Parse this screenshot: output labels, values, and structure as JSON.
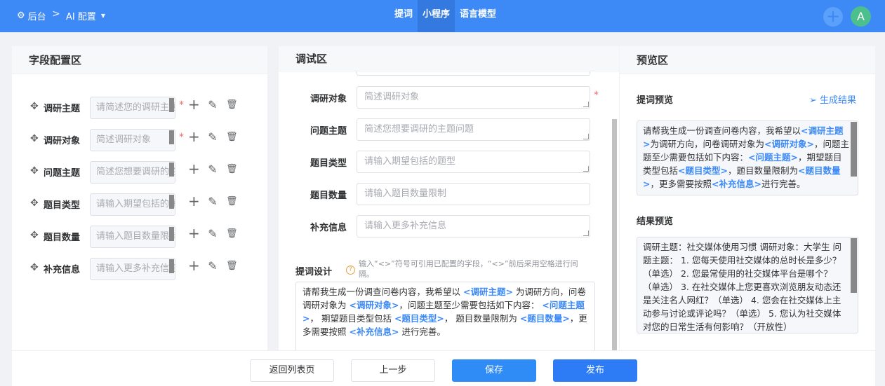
{
  "header": {
    "home_label": "后台",
    "separator": ">",
    "ai_config_label": "AI 配置",
    "tabs": [
      {
        "label": "提词",
        "active": false
      },
      {
        "label": "小程序",
        "active": true
      },
      {
        "label": "语言模型",
        "active": false
      }
    ],
    "avatar_letter": "A",
    "add_symbol": "+"
  },
  "field_panel": {
    "title": "字段配置区",
    "rows": [
      {
        "label": "调研主题",
        "placeholder": "请简述您的调研主题",
        "required": true
      },
      {
        "label": "调研对象",
        "placeholder": "简述调研对象",
        "required": true
      },
      {
        "label": "问题主题",
        "placeholder": "简述您想要调研的主题问题",
        "required": false
      },
      {
        "label": "题目类型",
        "placeholder": "请输入期望包括的题型",
        "required": false
      },
      {
        "label": "题目数量",
        "placeholder": "请输入题目数量限制",
        "required": false
      },
      {
        "label": "补充信息",
        "placeholder": "请输入更多补充信息",
        "required": false
      }
    ],
    "required_mark": "*",
    "icons": {
      "drag": "drag-move-icon",
      "add": "plus-icon",
      "edit": "edit-icon",
      "delete": "trash-icon"
    }
  },
  "debug_panel": {
    "title": "调试区",
    "fields": [
      {
        "label": "调研对象",
        "placeholder": "简述调研对象",
        "required": true
      },
      {
        "label": "问题主题",
        "placeholder": "简述您想要调研的主题问题",
        "required": false
      },
      {
        "label": "题目类型",
        "placeholder": "请输入期望包括的题型",
        "required": false
      },
      {
        "label": "题目数量",
        "placeholder": "请输入题目数量限制",
        "required": false
      },
      {
        "label": "补充信息",
        "placeholder": "请输入更多补充信息",
        "required": false
      }
    ],
    "prompt_label": "提词设计",
    "prompt_hint": "输入“<>”符号可引用已配置的字段，“<>”前后采用空格进行间隔。",
    "prompt_parts": [
      {
        "t": "请帮我生成一份调查问卷内容，我希望以 ",
        "tag": false
      },
      {
        "t": "<调研主题>",
        "tag": true
      },
      {
        "t": " 为调研方向，问卷调研对象为 ",
        "tag": false
      },
      {
        "t": "<调研对象>",
        "tag": true
      },
      {
        "t": "，问题主题至少需要包括如下内容：  ",
        "tag": false
      },
      {
        "t": "<问题主题>",
        "tag": true
      },
      {
        "t": "，  期望题目类型包括 ",
        "tag": false
      },
      {
        "t": "<题目类型>",
        "tag": true
      },
      {
        "t": "，  题目数量限制为 ",
        "tag": false
      },
      {
        "t": "<题目数量>",
        "tag": true
      },
      {
        "t": "，更多需要按照 ",
        "tag": false
      },
      {
        "t": "<补充信息>",
        "tag": true
      },
      {
        "t": " 进行完善。",
        "tag": false
      }
    ]
  },
  "preview_panel": {
    "title": "预览区",
    "prompt_preview_label": "提词预览",
    "generate_label": "生成结果",
    "prompt_preview_parts": [
      {
        "t": "请帮我生成一份调查问卷内容，我希望以",
        "tag": false
      },
      {
        "t": "<调研主题>",
        "tag": true
      },
      {
        "t": "为调研方向，问卷调研对象为",
        "tag": false
      },
      {
        "t": "<调研对象>",
        "tag": true
      },
      {
        "t": "，问题主题至少需要包括如下内容：",
        "tag": false
      },
      {
        "t": "<问题主题>",
        "tag": true
      },
      {
        "t": "，期望题目类型包括",
        "tag": false
      },
      {
        "t": "<题目类型>",
        "tag": true
      },
      {
        "t": "，题目数量限制为",
        "tag": false
      },
      {
        "t": "<题目数量>",
        "tag": true
      },
      {
        "t": "，更多需要按照",
        "tag": false
      },
      {
        "t": "<补充信息>",
        "tag": true
      },
      {
        "t": "进行完善。",
        "tag": false
      }
    ],
    "result_label": "结果预览",
    "result_text": "调研主题：社交媒体使用习惯 调研对象：大学生 问题主题： 1. 您每天使用社交媒体的总时长是多少？（单选） 2. 您最常使用的社交媒体平台是哪个？（单选） 3. 在社交媒体上您更喜欢浏览朋友动态还是关注名人网红？（单选） 4. 您会在社交媒体上主动参与讨论或评论吗？（单选） 5. 您认为社交媒体对您的日常生活有何影响？（开放性）"
  },
  "footer": {
    "back_label": "返回列表页",
    "prev_label": "上一步",
    "save_label": "保存",
    "publish_label": "发布"
  },
  "colors": {
    "header_bg": "#3d8af7",
    "accent": "#3d8af7",
    "required": "#f56c6c",
    "avatar": "#4bbf8c"
  }
}
